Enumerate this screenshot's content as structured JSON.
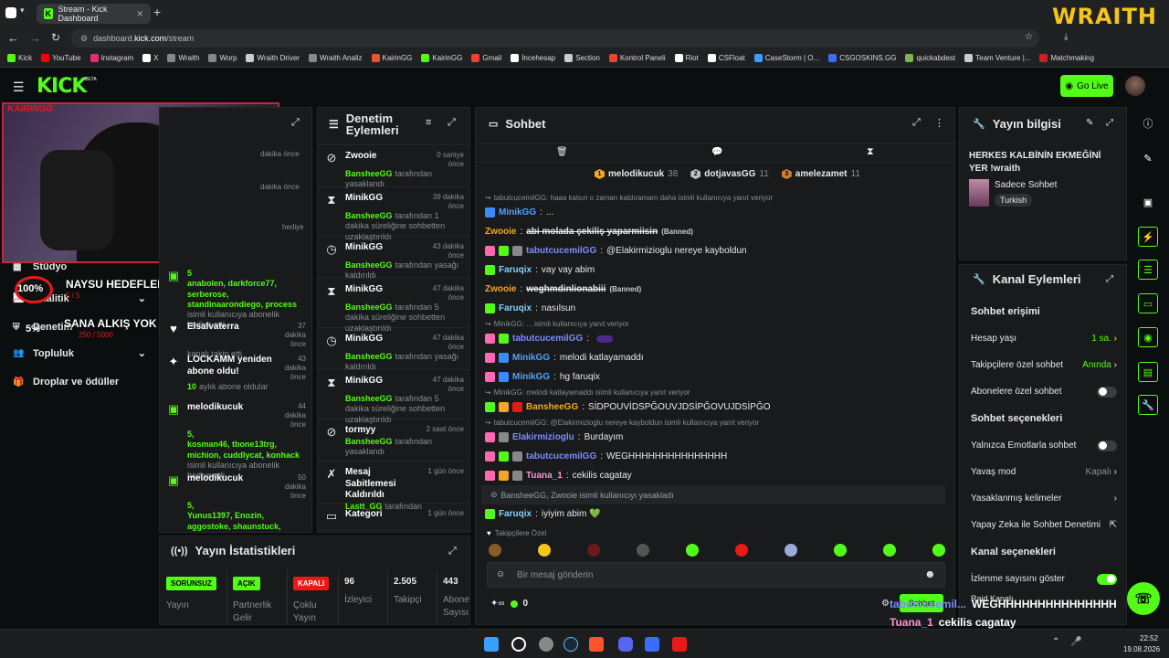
{
  "browser": {
    "tab_title": "Stream - Kick Dashboard",
    "url_prefix": "dashboard.",
    "url_domain": "kick.com",
    "url_path": "/stream",
    "bookmarks": [
      {
        "label": "Kick",
        "color": "#53fc18"
      },
      {
        "label": "YouTube",
        "color": "#ff0000"
      },
      {
        "label": "Instagram",
        "color": "#e1306c"
      },
      {
        "label": "X",
        "color": "#ffffff"
      },
      {
        "label": "Wraith",
        "color": "#888888"
      },
      {
        "label": "Worp",
        "color": "#888888"
      },
      {
        "label": "Wraith Driver",
        "color": "#cccccc"
      },
      {
        "label": "Wraith Analiz",
        "color": "#888888"
      },
      {
        "label": "KairinGG",
        "color": "#e8552f"
      },
      {
        "label": "KairinGG",
        "color": "#53fc18"
      },
      {
        "label": "Gmail",
        "color": "#ea4335"
      },
      {
        "label": "İncehesap",
        "color": "#ffffff"
      },
      {
        "label": "Section",
        "color": "#cccccc"
      },
      {
        "label": "Kontrol Paneli",
        "color": "#ea4335"
      },
      {
        "label": "Riot",
        "color": "#ffffff"
      },
      {
        "label": "CSFloat",
        "color": "#ffffff"
      },
      {
        "label": "CaseStorm | O...",
        "color": "#3aa0ff"
      },
      {
        "label": "CSGOSKINS.GG",
        "color": "#3a6cff"
      },
      {
        "label": "quickabdest",
        "color": "#7ab648"
      },
      {
        "label": "Team Venture |...",
        "color": "#cccccc"
      },
      {
        "label": "Matchmaking",
        "color": "#cc2222"
      }
    ]
  },
  "header": {
    "logo": "KICK",
    "beta": "BETA",
    "go_live": "Go Live"
  },
  "overlay": {
    "wraith": "WRAITH",
    "cam_tag": "KAIRINGG",
    "goal_pct": "100%",
    "goal_title": "NAYSU HEDEFLER",
    "goal_sub": "5 / 5",
    "goal2_pct": "5%",
    "goal2_title": "SANA ALKIŞ YOK ANCA KICK",
    "goal2_sub": "250 / 5000"
  },
  "sidebar": {
    "items": [
      {
        "label": "Stüdyo"
      },
      {
        "label": "Analitik"
      },
      {
        "label": "Denetim"
      },
      {
        "label": "Topluluk"
      },
      {
        "label": "Droplar ve ödüller"
      }
    ]
  },
  "activity": {
    "events": [
      {
        "num": "5",
        "names": "anabolen, darkforce77, serberose, standinaarondiego, process",
        "desc": "isimli kullanıcıya abonelik hediye etti."
      },
      {
        "name": "Elsalvaterra",
        "time": "37 dakika önce",
        "desc": "kanalı takip etti"
      },
      {
        "name": "LOCKAMM yeniden abone oldu!",
        "time": "43 dakika önce",
        "desc_green": "10",
        "desc": "aylık abone oldular"
      },
      {
        "name": "melodikucuk",
        "time": "44 dakika önce",
        "num": "5,",
        "names": "kosman46, tbone13trg, michion, cuddlycat, konhack",
        "desc": "isimli kullanıcıya abonelik hediye etti."
      },
      {
        "name": "melodikucuk",
        "time": "50 dakika önce",
        "num": "5,",
        "names": "Yunus1397, Enozin, aggostoke, shaunstuck, labbi21",
        "desc": "isimli kullanıcıya abonelik hediye etti."
      }
    ],
    "time_top1": "dakika önce",
    "time_top2": "dakika önce",
    "desc_top": "hediye"
  },
  "moderation": {
    "title_line1": "Denetim",
    "title_line2": "Eylemleri",
    "events": [
      {
        "icon": "ban",
        "name": "Zwooie",
        "time": "0 saniye önce",
        "mod": "BansheeGG",
        "desc": "tarafından yasaklandı"
      },
      {
        "icon": "timeout",
        "name": "MinikGG",
        "time": "39 dakika önce",
        "mod": "BansheeGG",
        "desc": "tarafından 1 dakika süreliğine sohbetten uzaklaştırıldı"
      },
      {
        "icon": "unban",
        "name": "MinikGG",
        "time": "43 dakika önce",
        "mod": "BansheeGG",
        "desc": "tarafından yasağı kaldırıldı"
      },
      {
        "icon": "timeout",
        "name": "MinikGG",
        "time": "47 dakika önce",
        "mod": "BansheeGG",
        "desc": "tarafından 5 dakika süreliğine sohbetten uzaklaştırıldı"
      },
      {
        "icon": "unban",
        "name": "MinikGG",
        "time": "47 dakika önce",
        "mod": "BansheeGG",
        "desc": "tarafından yasağı kaldırıldı"
      },
      {
        "icon": "timeout",
        "name": "MinikGG",
        "time": "47 dakika önce",
        "mod": "BansheeGG",
        "desc": "tarafından 5 dakika süreliğine sohbetten uzaklaştırıldı"
      },
      {
        "icon": "ban",
        "name": "tormyy",
        "time": "2 saat önce",
        "mod": "BansheeGG",
        "desc": "tarafından yasaklandı"
      },
      {
        "icon": "pin",
        "name": "Mesaj Sabitlemesi Kaldırıldı",
        "time": "1 gün önce",
        "mod": "Lastt_GG",
        "desc": "tarafından"
      },
      {
        "icon": "cat",
        "name": "Kategori",
        "time": "1 gün önce",
        "mod": "",
        "desc": ""
      }
    ]
  },
  "stats": {
    "title": "Yayın İstatistikleri",
    "items": [
      {
        "pill": "SORUNSUZ",
        "color": "#53fc18",
        "label1": "Yayın",
        "label2": ""
      },
      {
        "pill": "AÇIK",
        "color": "#53fc18",
        "label1": "Partnerlik",
        "label2": "Gelir"
      },
      {
        "pill": "KAPALI",
        "color": "#e91916",
        "label1": "Çoklu",
        "label2": "Yayın"
      },
      {
        "value": "96",
        "label1": "İzleyici"
      },
      {
        "value": "2.505",
        "label1": "Takipçi"
      },
      {
        "value": "443",
        "label1": "Abone",
        "label2": "Sayısı"
      }
    ]
  },
  "chat": {
    "title": "Sohbet",
    "top": [
      {
        "rank": "1",
        "name": "melodikucuk",
        "n": "38",
        "color": "#f5a623"
      },
      {
        "rank": "2",
        "name": "dotjavasGG",
        "n": "11",
        "color": "#c0c0c0"
      },
      {
        "rank": "3",
        "name": "amelezamet",
        "n": "11",
        "color": "#cd7f32"
      }
    ],
    "messages": [
      {
        "type": "reply",
        "text": "tabutcucemilGG: haaa kalsın o zaman kaldıramam daha isimli kullanıcıya yanıt veriyor"
      },
      {
        "type": "msg",
        "badges": [
          "#3a8bff"
        ],
        "user": "MinikGG",
        "ucolor": "#4fa3ff",
        "text": "..."
      },
      {
        "type": "msg",
        "badges": [],
        "user": "Zwooie",
        "ucolor": "#f5a623",
        "text": "abi molada çekiliş yaparmiisin",
        "strike": true,
        "note": "(Banned)"
      },
      {
        "type": "msg",
        "badges": [
          "#ff69b4",
          "#53fc18",
          "#888"
        ],
        "user": "tabutcucemilGG",
        "ucolor": "#7b8cff",
        "text": "@Elakirmizioglu nereye kayboldun"
      },
      {
        "type": "msg",
        "badges": [
          "#53fc18"
        ],
        "user": "Faruqix",
        "ucolor": "#7fd3ff",
        "text": "vay vay abim"
      },
      {
        "type": "msg",
        "badges": [],
        "user": "Zwooie",
        "ucolor": "#f5a623",
        "text": "weghmdinlionabiii",
        "strike": true,
        "note": "(Banned)"
      },
      {
        "type": "msg",
        "badges": [
          "#53fc18"
        ],
        "user": "Faruqix",
        "ucolor": "#7fd3ff",
        "text": "nasılsun"
      },
      {
        "type": "reply",
        "text": "MinikGG: ... isimli kullanıcıya yanıt veriyor"
      },
      {
        "type": "msg",
        "badges": [
          "#ff69b4",
          "#53fc18"
        ],
        "user": "tabutcucemilGG",
        "ucolor": "#7b8cff",
        "text": ""
      },
      {
        "type": "msg",
        "badges": [
          "#ff69b4",
          "#3a8bff"
        ],
        "user": "MinikGG",
        "ucolor": "#4fa3ff",
        "text": "melodi katlayamaddı"
      },
      {
        "type": "msg",
        "badges": [
          "#ff69b4",
          "#3a8bff"
        ],
        "user": "MinikGG",
        "ucolor": "#4fa3ff",
        "text": "hg faruqix"
      },
      {
        "type": "reply",
        "text": "MinikGG: melodi katlayamaddı isimli kullanıcıya yanıt veriyor"
      },
      {
        "type": "msg",
        "badges": [
          "#53fc18",
          "#f5a623",
          "#e91916"
        ],
        "user": "BansheeGG",
        "ucolor": "#f5a623",
        "text": "SİDPOUVİDSPĞOUVJDSİPĞOVUJDSİPĞO"
      },
      {
        "type": "reply",
        "text": "tabutcucemilGG: @Elakirmizioglu nereye kayboldun isimli kullanıcıya yanıt veriyor"
      },
      {
        "type": "msg",
        "badges": [
          "#ff69b4",
          "#888"
        ],
        "user": "Elakirmizioglu",
        "ucolor": "#7b8cff",
        "text": "Burdayım"
      },
      {
        "type": "msg",
        "badges": [
          "#ff69b4",
          "#53fc18",
          "#888"
        ],
        "user": "tabutcucemilGG",
        "ucolor": "#7b8cff",
        "text": "WEGHHHHHHHHHHHHHHH"
      },
      {
        "type": "msg",
        "badges": [
          "#ff69b4",
          "#f5a623",
          "#888"
        ],
        "user": "Tuana_1",
        "ucolor": "#ff8fd0",
        "text": "cekilis cagatay"
      },
      {
        "type": "system",
        "text": "BansheeGG, Zwooie isimli kullanıcıyı yasakladı"
      },
      {
        "type": "msg",
        "badges": [
          "#53fc18"
        ],
        "user": "Faruqix",
        "ucolor": "#7fd3ff",
        "text": "iyiyim abim 💚"
      }
    ],
    "follower_only": "Takipçilere Özel",
    "input_placeholder": "Bir mesaj gönderin",
    "points": "0",
    "send": "Sohbet"
  },
  "info": {
    "title": "Yayın bilgisi",
    "stream_title": "HERKES KALBİNİN EKMEĞİNİ YER !wraith",
    "category": "Sadece Sohbet",
    "lang": "Turkish"
  },
  "channel": {
    "title": "Kanal Eylemleri",
    "chat_access": "Sohbet erişimi",
    "account_age": "Hesap yaşı",
    "account_age_val": "1 sa.",
    "follower_chat": "Takipçilere özel sohbet",
    "follower_chat_val": "Anında",
    "sub_chat": "Abonelere özel sohbet",
    "chat_options": "Sohbet seçenekleri",
    "emote_only": "Yalnızca Emotlarla sohbet",
    "slow_mode": "Yavaş mod",
    "slow_mode_val": "Kapalı",
    "banned_words": "Yasaklanmış kelimeler",
    "ai_mod": "Yapay Zeka ile Sohbet Denetimi",
    "channel_options": "Kanal seçenekleri",
    "show_viewers": "İzlenme sayısını göster",
    "raid": "Raid Kanalı"
  },
  "overlay_chat": [
    {
      "user": "tabutcucemil...",
      "text": "WEGHHHHHHHHHHHHHHH"
    },
    {
      "user": "Tuana_1",
      "text": "cekilis cagatay"
    },
    {
      "user": "Faruqix",
      "text": "iyiyim abim 💚"
    }
  ],
  "taskbar": {
    "time": "22:52",
    "date": "19.08.2026"
  }
}
